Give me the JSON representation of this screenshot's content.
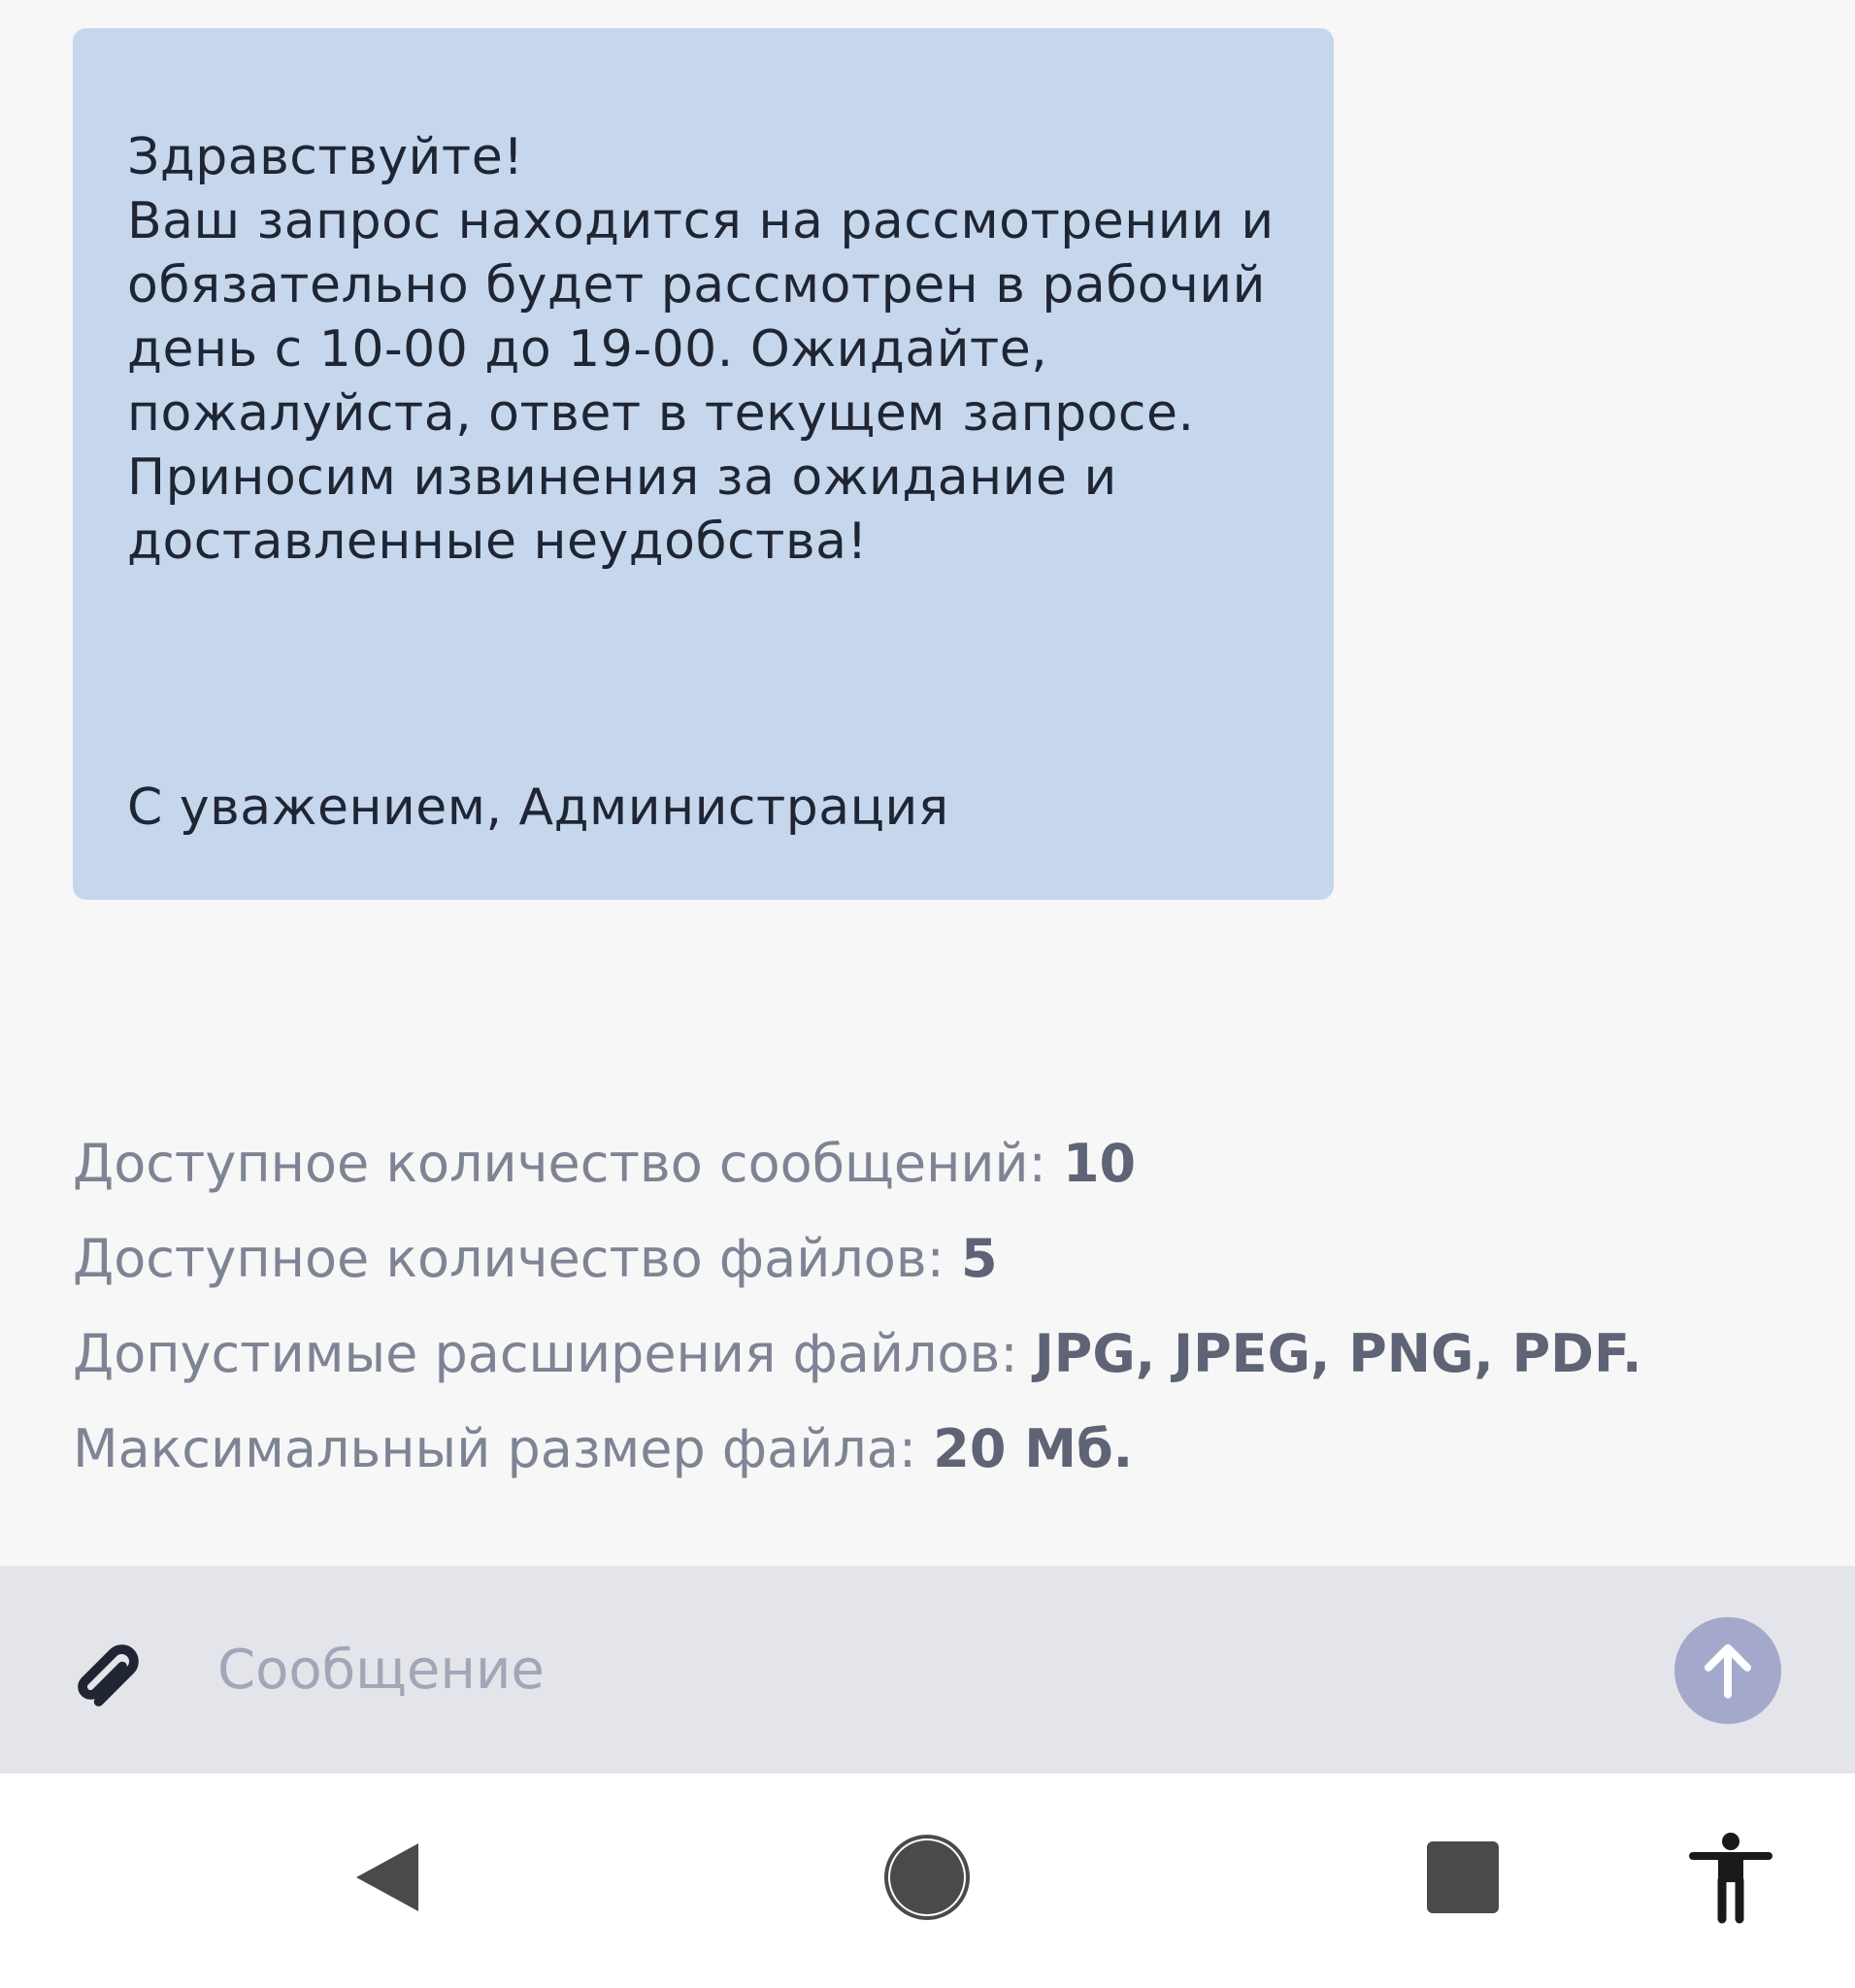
{
  "message": {
    "body": "Здравствуйте!\nВаш запрос находится на рассмотрении и обязательно будет рассмотрен в рабочий день с 10-00 до 19-00. Ожидайте, пожалуйста, ответ в текущем запросе.\nПриносим извинения за ожидание и доставленные неудобства!",
    "signature": "С уважением, Администрация"
  },
  "limits": [
    {
      "label": "Доступное количество сообщений: ",
      "value": "10"
    },
    {
      "label": "Доступное количество файлов: ",
      "value": "5"
    },
    {
      "label": "Допустимые расширения файлов: ",
      "value": "JPG, JPEG, PNG, PDF."
    },
    {
      "label": "Максимальный размер файла: ",
      "value": "20 Мб."
    }
  ],
  "composer": {
    "placeholder": "Сообщение",
    "value": ""
  },
  "icons": {
    "attach": "paperclip-icon",
    "send": "arrow-up-icon",
    "back": "triangle-back-icon",
    "home": "circle-home-icon",
    "recents": "square-recents-icon",
    "accessibility": "accessibility-person-icon"
  },
  "colors": {
    "bubble": "#c6d6ed",
    "send_button": "#a4a8cb",
    "input_bar": "#e4e5ea"
  }
}
